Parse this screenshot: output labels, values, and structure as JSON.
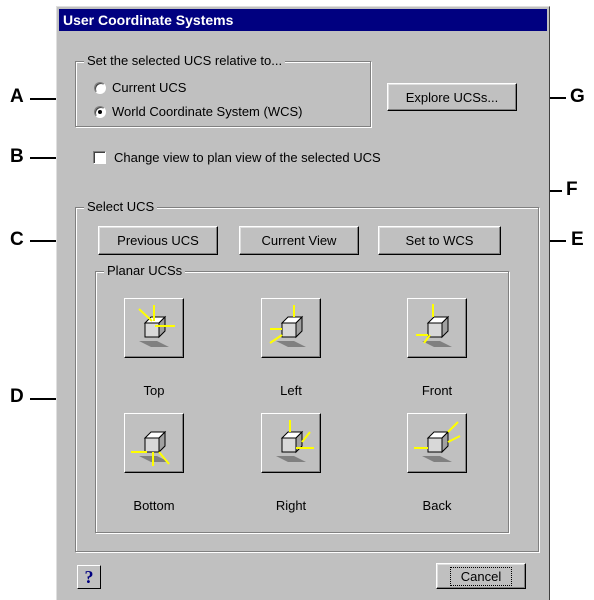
{
  "dialog": {
    "title": "User Coordinate Systems",
    "relative_group": {
      "title": "Set the selected UCS relative to...",
      "options": [
        {
          "label": "Current UCS",
          "selected": false
        },
        {
          "label": "World Coordinate System (WCS)",
          "selected": true
        }
      ]
    },
    "explore_button": "Explore UCSs...",
    "plan_view_checkbox": {
      "label": "Change view to plan view of the selected UCS",
      "checked": false
    },
    "select_group": {
      "title": "Select UCS",
      "previous_button": "Previous UCS",
      "current_view_button": "Current View",
      "set_wcs_button": "Set to WCS",
      "planar_group": {
        "title": "Planar UCSs",
        "items": [
          {
            "label": "Top",
            "icon": "cube-top-icon"
          },
          {
            "label": "Left",
            "icon": "cube-left-icon"
          },
          {
            "label": "Front",
            "icon": "cube-front-icon"
          },
          {
            "label": "Bottom",
            "icon": "cube-bottom-icon"
          },
          {
            "label": "Right",
            "icon": "cube-right-icon"
          },
          {
            "label": "Back",
            "icon": "cube-back-icon"
          }
        ]
      }
    },
    "help_button": "?",
    "cancel_button": "Cancel"
  },
  "callouts": [
    "A",
    "B",
    "C",
    "D",
    "E",
    "F",
    "G"
  ],
  "colors": {
    "title_bar": "#000080",
    "face": "#c0c0c0",
    "axis_highlight": "#ffff00"
  }
}
